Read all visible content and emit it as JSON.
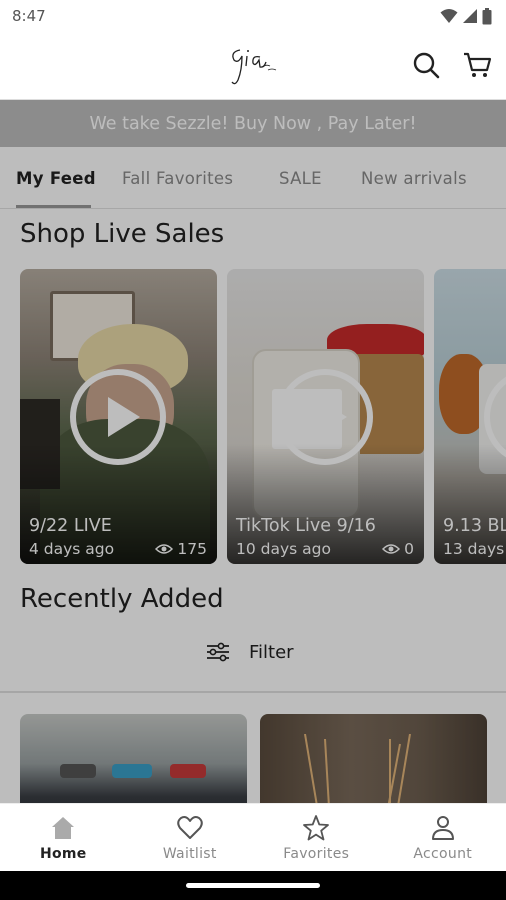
{
  "status_bar": {
    "time": "8:47",
    "icons": [
      "wifi-icon",
      "signal-icon",
      "battery-icon"
    ]
  },
  "header": {
    "logo_text": "Gia & Co.",
    "icons": [
      "search-icon",
      "cart-icon"
    ]
  },
  "banner": {
    "text": "We take Sezzle! Buy Now , Pay Later!",
    "background": "#bdbdbd"
  },
  "tabs": [
    {
      "label": "My Feed",
      "active": true
    },
    {
      "label": "Fall Favorites",
      "active": false
    },
    {
      "label": "SALE",
      "active": false
    },
    {
      "label": "New arrivals",
      "active": false
    }
  ],
  "live_sales": {
    "title": "Shop Live Sales",
    "cards": [
      {
        "title": "9/22 LIVE",
        "age": "4 days ago",
        "views": "175"
      },
      {
        "title": "TikTok Live 9/16",
        "age": "10 days ago",
        "views": "0"
      },
      {
        "title": "9.13 BL",
        "age": "13 days"
      }
    ]
  },
  "recently_added": {
    "title": "Recently Added",
    "filter_label": "Filter"
  },
  "bottom_nav": [
    {
      "label": "Home",
      "icon": "home-icon",
      "active": true
    },
    {
      "label": "Waitlist",
      "icon": "heart-icon",
      "active": false
    },
    {
      "label": "Favorites",
      "icon": "star-icon",
      "active": false
    },
    {
      "label": "Account",
      "icon": "account-icon",
      "active": false
    }
  ],
  "colors": {
    "overlay": "#000000",
    "active_text": "#222222",
    "inactive_text": "#8a8a8a"
  }
}
